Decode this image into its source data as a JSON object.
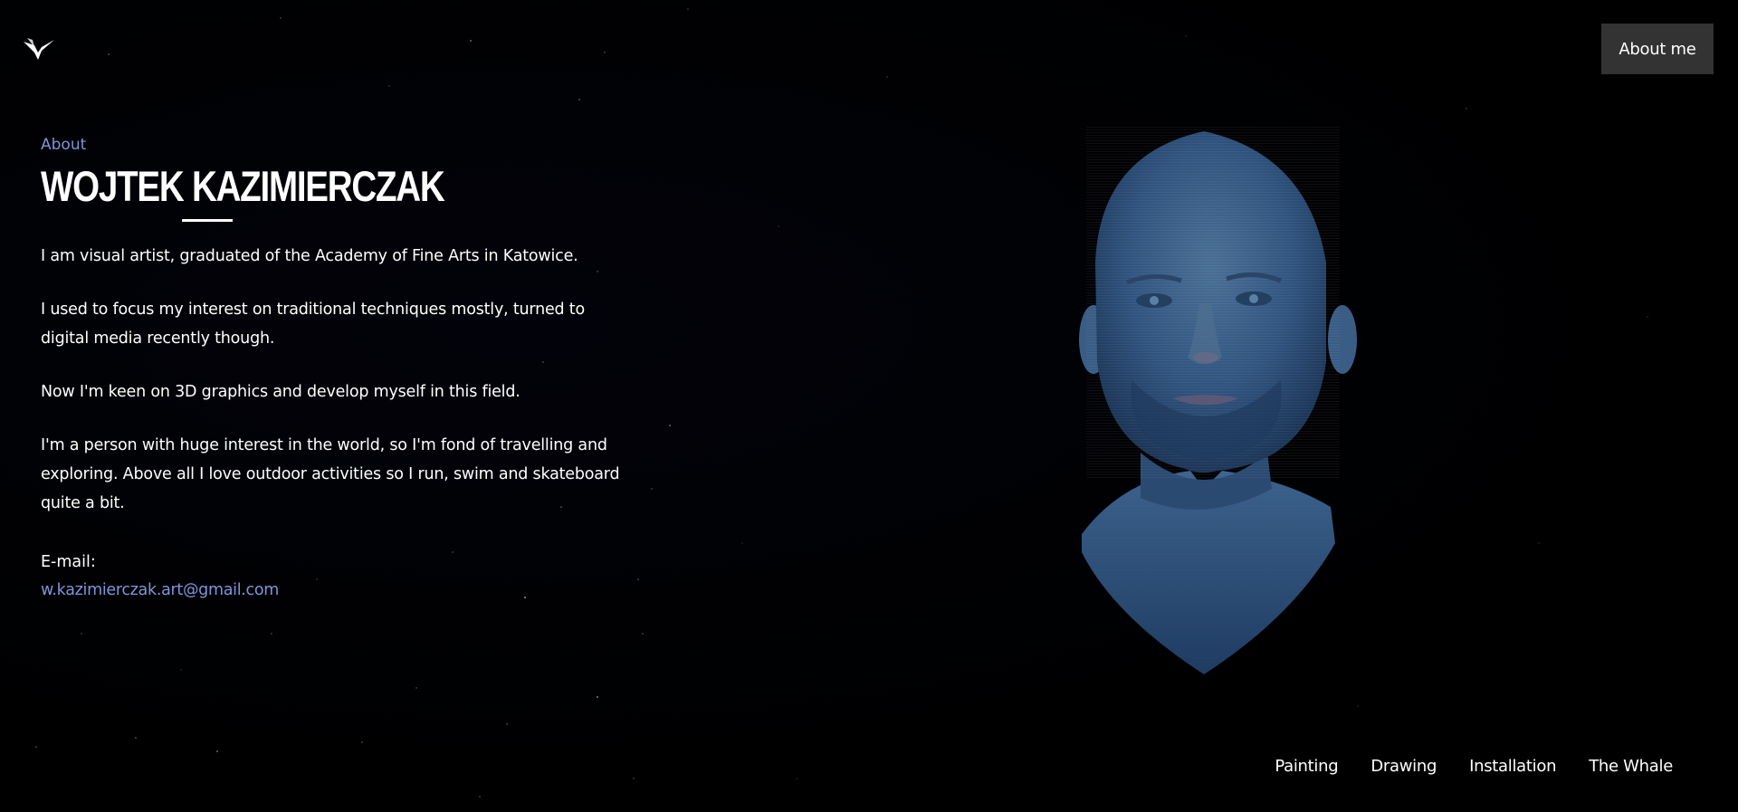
{
  "header": {
    "logo_icon": "bird-logo-icon",
    "about_button_label": "About me"
  },
  "about": {
    "eyebrow": "About",
    "name": "WOJTEK KAZIMIERCZAK",
    "paragraphs": [
      "I am visual artist, graduated of the Academy of Fine Arts in Katowice.",
      "I used to focus my interest on traditional techniques mostly, turned to digital media recently though.",
      "Now I'm keen on 3D graphics and develop myself in this field.",
      "I'm a person with huge interest in the world, so I'm fond of travelling and exploring. Above all I love outdoor activities so I run, swim and skateboard quite a bit."
    ],
    "email_label": "E-mail:",
    "email": "w.kazimierczak.art@gmail.com"
  },
  "portrait": {
    "icon": "3d-head-portrait"
  },
  "nav": {
    "items": [
      {
        "label": "Painting"
      },
      {
        "label": "Drawing"
      },
      {
        "label": "Installation"
      },
      {
        "label": "The Whale"
      }
    ]
  },
  "colors": {
    "background": "#000000",
    "accent": "#7f95d8",
    "button": "#333333",
    "portrait": "#2d4f7a"
  }
}
